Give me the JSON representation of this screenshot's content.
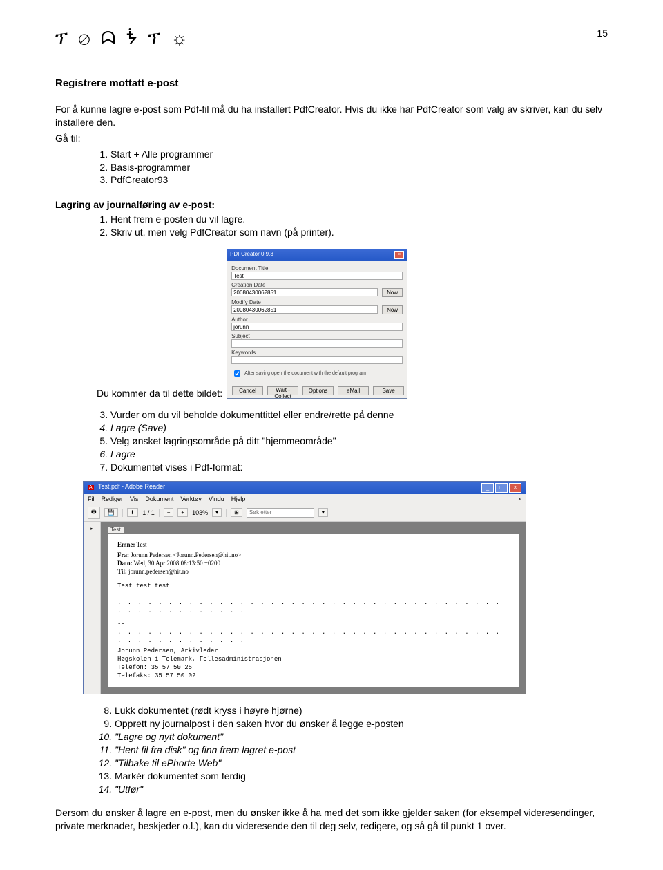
{
  "page_number": "15",
  "header_glyphs": "ፕ ⊘ ᗣ ᖭ ፕ ☼",
  "heading": "Registrere mottatt e-post",
  "intro1": "For å kunne lagre e-post som Pdf-fil må du ha installert PdfCreator. Hvis du ikke har PdfCreator som valg av skriver, kan du selv installere den.",
  "goto": "Gå til:",
  "goto_items": [
    "Start + Alle programmer",
    "Basis-programmer",
    "PdfCreator93"
  ],
  "subheading": "Lagring av journalføring av e-post:",
  "steps1": [
    "Hent frem e-posten du vil lagre.",
    "Skriv ut, men velg PdfCreator som navn (på printer)."
  ],
  "caption_before_dialog": "Du kommer da til dette bildet:",
  "dialog": {
    "title": "PDFCreator 0.9.3",
    "labels": {
      "doc_title": "Document Title",
      "creation": "Creation Date",
      "modify": "Modify Date",
      "author": "Author",
      "subject": "Subject",
      "keywords": "Keywords"
    },
    "values": {
      "doc_title": "Test",
      "creation": "20080430062851",
      "modify": "20080430062851",
      "author": "jorunn"
    },
    "now_btn": "Now",
    "check_label": "After saving open the document with the default program",
    "buttons": [
      "Cancel",
      "Wait - Collect",
      "Options",
      "eMail",
      "Save"
    ]
  },
  "steps2": [
    "Vurder om du vil beholde dokumenttittel eller endre/rette på denne",
    "Lagre (Save)",
    "Velg ønsket lagringsområde på ditt \"hjemmeområde\"",
    "Lagre",
    "Dokumentet vises i Pdf-format:"
  ],
  "steps2_italic": [
    false,
    true,
    false,
    true,
    false
  ],
  "reader": {
    "title": "Test.pdf - Adobe Reader",
    "menus": [
      "Fil",
      "Rediger",
      "Vis",
      "Dokument",
      "Verktøy",
      "Vindu",
      "Hjelp"
    ],
    "toolbar": {
      "page_indicator": "1 / 1",
      "zoom": "103%",
      "search_placeholder": "Søk etter"
    },
    "tab": "Test",
    "email": {
      "subject_lbl": "Emne:",
      "subject": "Test",
      "from_lbl": "Fra:",
      "from": "Jorunn Pedersen <Jorunn.Pedersen@hit.no>",
      "date_lbl": "Dato:",
      "date": "Wed, 30 Apr 2008 08:13:50 +0200",
      "to_lbl": "Til:",
      "to": "jorunn.pedersen@hit.no",
      "body": "Test test test",
      "sep": "--",
      "sig": [
        "Jorunn Pedersen, Arkivleder|",
        "Høgskolen i Telemark, Fellesadministrasjonen",
        "Telefon: 35 57 50 25",
        "Telefaks: 35 57 50 02"
      ]
    }
  },
  "steps3": [
    "Lukk dokumentet (rødt kryss i høyre hjørne)",
    "Opprett ny journalpost i den saken hvor du ønsker å legge e-posten",
    "\"Lagre og nytt dokument\"",
    "\"Hent fil fra disk\" og finn frem lagret e-post",
    "\"Tilbake til ePhorte Web\"",
    "Markér dokumentet som ferdig",
    "\"Utfør\""
  ],
  "steps3_italic": [
    false,
    false,
    true,
    true,
    true,
    false,
    true
  ],
  "closing": "Dersom du ønsker å lagre en e-post, men du ønsker ikke å ha med det som ikke gjelder saken (for eksempel videresendinger, private merknader, beskjeder o.l.), kan du videresende den til deg selv, redigere, og så gå til punkt 1 over."
}
